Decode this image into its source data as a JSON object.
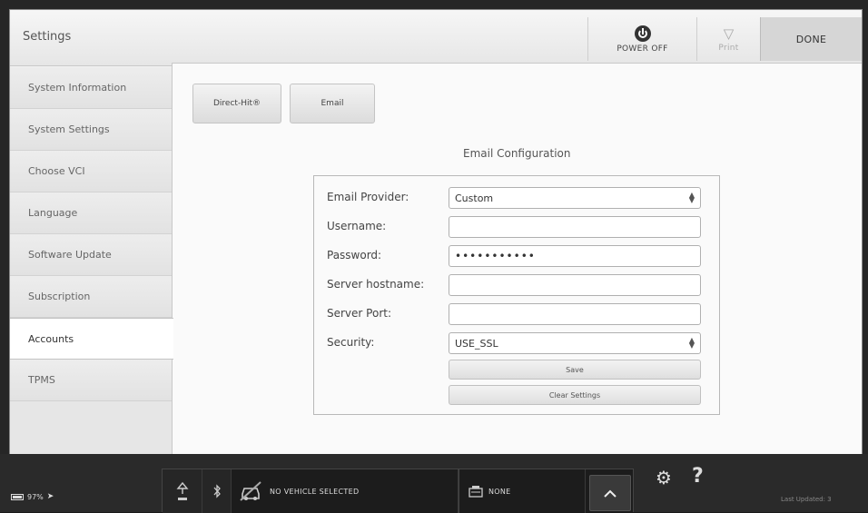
{
  "header": {
    "title": "Settings",
    "power_label": "POWER OFF",
    "print_label": "Print",
    "done_label": "DONE"
  },
  "sidebar": {
    "items": [
      {
        "label": "System Information"
      },
      {
        "label": "System Settings"
      },
      {
        "label": "Choose VCI"
      },
      {
        "label": "Language"
      },
      {
        "label": "Software Update"
      },
      {
        "label": "Subscription"
      },
      {
        "label": "Accounts",
        "active": true
      },
      {
        "label": "TPMS"
      }
    ]
  },
  "tabs": {
    "direct_hit": "Direct-Hit®",
    "email": "Email"
  },
  "email_config": {
    "title": "Email Configuration",
    "provider_label": "Email Provider:",
    "provider_value": "Custom",
    "username_label": "Username:",
    "username_value": "",
    "password_label": "Password:",
    "password_value": "•••••••••••",
    "hostname_label": "Server hostname:",
    "hostname_value": "",
    "port_label": "Server Port:",
    "port_value": "",
    "security_label": "Security:",
    "security_value": "USE_SSL",
    "save_label": "Save",
    "clear_label": "Clear Settings"
  },
  "status_bar": {
    "battery": "97%",
    "vehicle": "NO VEHICLE SELECTED",
    "vci": "NONE",
    "last_updated": "Last Updated: 3"
  },
  "icons": [
    "power-icon",
    "print-icon",
    "signal-icon",
    "bluetooth-icon",
    "car-icon",
    "vci-icon",
    "chevron-up-icon",
    "gear-icon",
    "help-icon",
    "battery-icon",
    "plug-icon"
  ]
}
